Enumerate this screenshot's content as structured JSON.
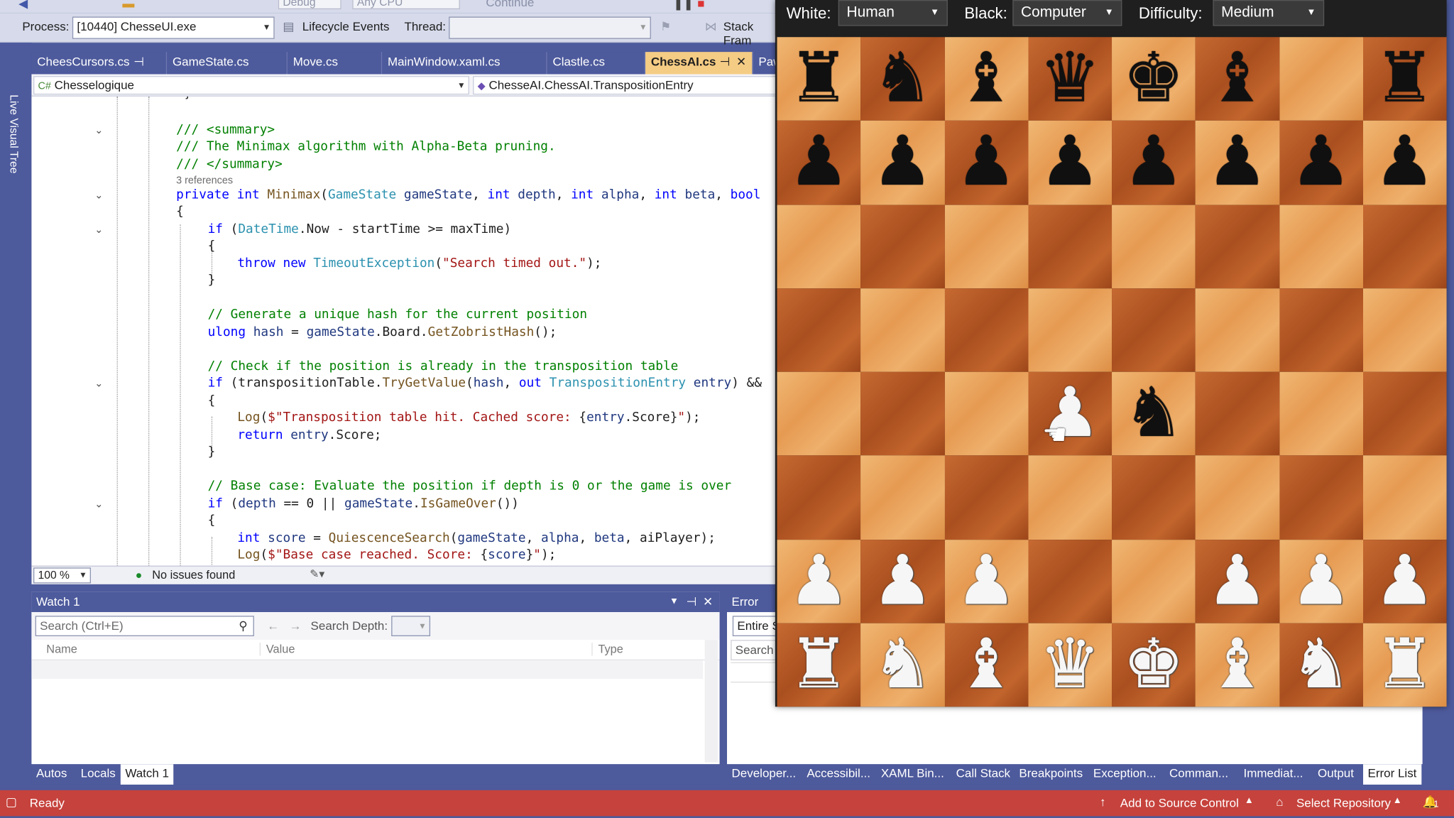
{
  "toolbar": {
    "debug_config": "Debug",
    "platform": "Any CPU",
    "continue_label": "Continue",
    "process_label": "Process:",
    "process_value": "[10440] ChesseUI.exe",
    "lifecycle_label": "Lifecycle Events",
    "thread_label": "Thread:",
    "thread_value": "",
    "stack_frame_label": "Stack Fram"
  },
  "side": {
    "live_visual_tree": "Live Visual Tree"
  },
  "tabs": [
    {
      "label": "CheesCursors.cs",
      "pinned": true
    },
    {
      "label": "GameState.cs"
    },
    {
      "label": "Move.cs"
    },
    {
      "label": "MainWindow.xaml.cs"
    },
    {
      "label": "Clastle.cs"
    },
    {
      "label": "ChessAI.cs",
      "active": true
    },
    {
      "label": "Paw"
    }
  ],
  "navbar": {
    "project": "Chesselogique",
    "member": "ChesseAI.ChessAI.TranspositionEntry"
  },
  "editor": {
    "references": "3 references",
    "lines": [
      "/// <summary>",
      "/// The Minimax algorithm with Alpha-Beta pruning.",
      "/// </summary>",
      "private int Minimax(GameState gameState, int depth, int alpha, int beta, bool",
      "{",
      "if (DateTime.Now - startTime >= maxTime)",
      "{",
      "throw new TimeoutException(\"Search timed out.\");",
      "}",
      "// Generate a unique hash for the current position",
      "ulong hash = gameState.Board.GetZobristHash();",
      "// Check if the position is already in the transposition table",
      "if (transpositionTable.TryGetValue(hash, out TranspositionEntry entry) &&",
      "{",
      "Log($\"Transposition table hit. Cached score: {entry.Score}\");",
      "return entry.Score;",
      "}",
      "// Base case: Evaluate the position if depth is 0 or the game is over",
      "if (depth == 0 || gameState.IsGameOver())",
      "{",
      "int score = QuiescenceSearch(gameState, alpha, beta, aiPlayer);",
      "Log($\"Base case reached. Score: {score}\");"
    ],
    "zoom": "100 %",
    "issues": "No issues found"
  },
  "watch": {
    "title": "Watch 1",
    "search_placeholder": "Search (Ctrl+E)",
    "search_depth_label": "Search Depth:",
    "columns": [
      "Name",
      "Value",
      "Type"
    ],
    "bottom_tabs": [
      "Autos",
      "Locals",
      "Watch 1"
    ]
  },
  "errorlist": {
    "title": "Error List",
    "scope": "Entire S",
    "search": "Search E",
    "bottom_tabs": [
      "Developer...",
      "Accessibil...",
      "XAML Bin...",
      "Call Stack",
      "Breakpoints",
      "Exception...",
      "Comman...",
      "Immediat...",
      "Output",
      "Error List"
    ]
  },
  "status": {
    "ready": "Ready",
    "source_control": "Add to Source Control",
    "repository": "Select Repository",
    "notifications": "1"
  },
  "chess": {
    "white_label": "White:",
    "white_value": "Human",
    "black_label": "Black:",
    "black_value": "Computer",
    "difficulty_label": "Difficulty:",
    "difficulty_value": "Medium",
    "board": [
      [
        "bR",
        "bN",
        "bB",
        "bQ",
        "bK",
        "bB",
        "",
        ""
      ],
      [
        "bP",
        "bP",
        "bP",
        "bP",
        "bP",
        "bP",
        "bP",
        "bP"
      ],
      [
        "",
        "",
        "",
        "",
        "",
        "",
        "",
        ""
      ],
      [
        "",
        "",
        "",
        "",
        "",
        "",
        "",
        ""
      ],
      [
        "",
        "",
        "",
        "wP",
        "bN",
        "",
        "",
        ""
      ],
      [
        "",
        "",
        "",
        "",
        "",
        "",
        "",
        ""
      ],
      [
        "wP",
        "wP",
        "wP",
        "",
        "",
        "wP",
        "wP",
        "wP"
      ],
      [
        "wR",
        "wN",
        "wB",
        "wQ",
        "wK",
        "wB",
        "wN",
        "wR"
      ]
    ],
    "extra_black_rook_h8": "bR"
  }
}
